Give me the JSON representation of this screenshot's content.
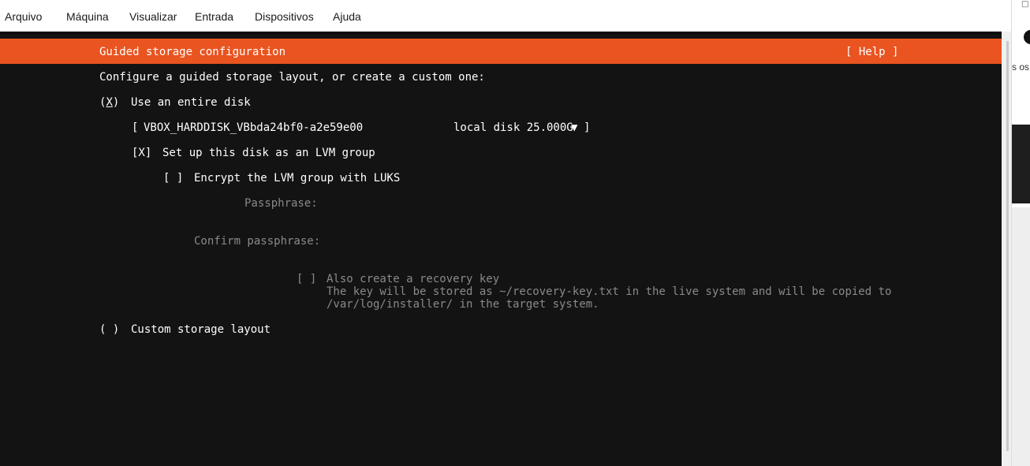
{
  "menubar": {
    "items": [
      "Arquivo",
      "Máquina",
      "Visualizar",
      "Entrada",
      "Dispositivos",
      "Ajuda"
    ]
  },
  "installer": {
    "header_title": "Guided storage configuration",
    "help_button": "[ Help ]",
    "intro": "Configure a guided storage layout, or create a custom one:",
    "use_entire_disk": {
      "marker_open": "(",
      "marker_mark": "X",
      "marker_close": ")",
      "label": "Use an entire disk"
    },
    "disk_selector": {
      "open": "[",
      "disk_name": "VBOX_HARDDISK_VBbda24bf0-a2e59e00",
      "disk_info": "local disk 25.000G",
      "arrow": "▼",
      "close": "]"
    },
    "lvm_checkbox": {
      "marker": "[X]",
      "label": "Set up this disk as an LVM group"
    },
    "luks_checkbox": {
      "marker": "[ ]",
      "label": "Encrypt the LVM group with LUKS"
    },
    "passphrase_label": "Passphrase:",
    "confirm_passphrase_label": "Confirm passphrase:",
    "recovery_key": {
      "marker": "[ ]",
      "label": "Also create a recovery key",
      "desc_line1": "The key will be stored as ~/recovery-key.txt in the live system and will be copied to",
      "desc_line2": "/var/log/installer/ in the target system."
    },
    "custom_layout": {
      "marker": "( )",
      "label": "Custom storage layout"
    }
  },
  "side_panel": {
    "text": "s os"
  },
  "colors": {
    "accent": "#e95420",
    "terminal_bg": "#131313",
    "dim_text": "#8a8a8a"
  }
}
